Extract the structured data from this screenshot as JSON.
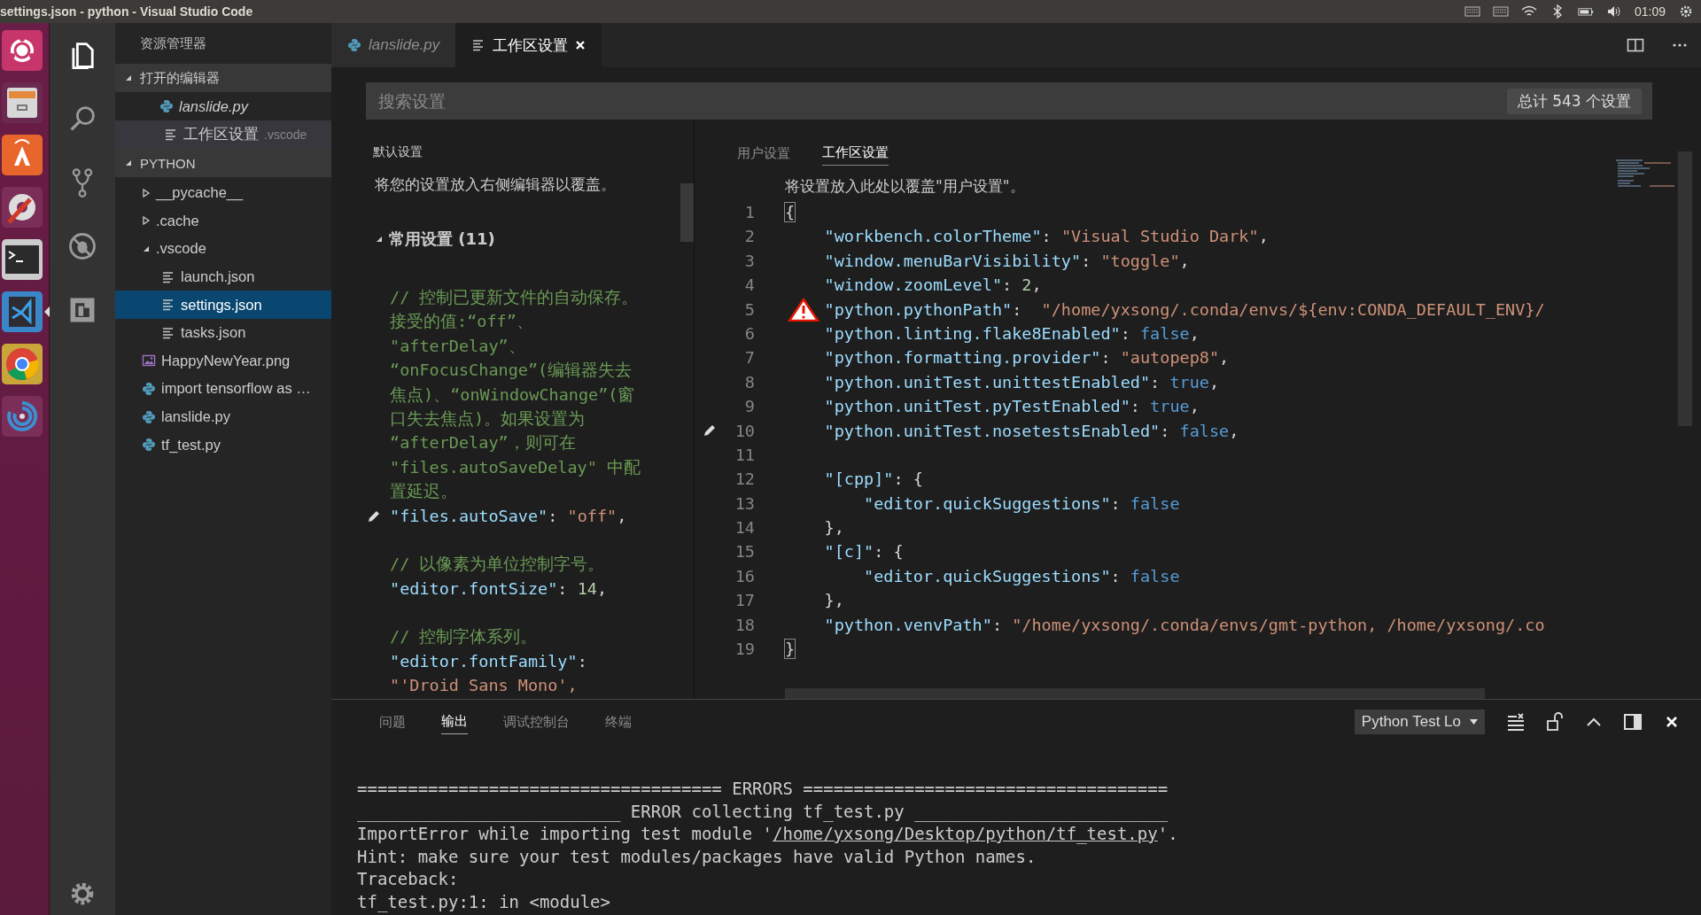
{
  "title_bar": {
    "title": "settings.json - python - Visual Studio Code",
    "clock": "01:09"
  },
  "launcher": {
    "items": [
      {
        "kind": "ubuntu",
        "selected": false
      },
      {
        "kind": "files",
        "selected": false
      },
      {
        "kind": "store",
        "selected": false
      },
      {
        "kind": "tools",
        "selected": false
      },
      {
        "kind": "terminal",
        "selected": false
      },
      {
        "kind": "vscode",
        "selected": true
      },
      {
        "kind": "chrome",
        "selected": false
      },
      {
        "kind": "spiral",
        "selected": false
      }
    ]
  },
  "activity_bar": {
    "items": [
      {
        "kind": "explorer",
        "selected": true
      },
      {
        "kind": "search",
        "selected": false
      },
      {
        "kind": "git",
        "selected": false
      },
      {
        "kind": "debug",
        "selected": false
      },
      {
        "kind": "extensions",
        "selected": false
      }
    ]
  },
  "sidebar": {
    "title": "资源管理器",
    "open_editors": {
      "title": "打开的编辑器",
      "expanded": true,
      "items": [
        {
          "kind": "python",
          "label": "lanslide.py",
          "preview": true,
          "selected": false
        },
        {
          "kind": "settings",
          "label": "工作区设置",
          "detail": ".vscode",
          "preview": false,
          "selected": true
        }
      ]
    },
    "folder": {
      "title": "PYTHON",
      "expanded": true,
      "items": [
        {
          "kind": "folder",
          "label": "__pycache__",
          "expanded": false,
          "selected": false
        },
        {
          "kind": "folder",
          "label": ".cache",
          "expanded": false,
          "selected": false
        },
        {
          "kind": "folder",
          "label": ".vscode",
          "expanded": true,
          "selected": false,
          "children": [
            {
              "kind": "json",
              "label": "launch.json",
              "selected": false
            },
            {
              "kind": "json",
              "label": "settings.json",
              "selected": true
            },
            {
              "kind": "json",
              "label": "tasks.json",
              "selected": false
            }
          ]
        },
        {
          "kind": "image",
          "label": "HappyNewYear.png",
          "selected": false
        },
        {
          "kind": "python",
          "label": "import tensorflow as …",
          "selected": false
        },
        {
          "kind": "python",
          "label": "lanslide.py",
          "selected": false
        },
        {
          "kind": "python",
          "label": "tf_test.py",
          "selected": false
        }
      ]
    }
  },
  "editor_tabs": [
    {
      "kind": "python",
      "label": "lanslide.py",
      "preview": true,
      "selected": false
    },
    {
      "kind": "settings",
      "label": "工作区设置",
      "preview": false,
      "selected": true
    }
  ],
  "search": {
    "placeholder": "搜索设置",
    "count": "总计 543 个设置"
  },
  "default_settings": {
    "title": "默认设置",
    "intro": "将您的设置放入右侧编辑器以覆盖。",
    "group": {
      "title": "常用设置 (11)",
      "expanded": true
    },
    "lines": [
      {
        "kind": "comment",
        "edited": false,
        "text": "// 控制已更新文件的自动保存。"
      },
      {
        "kind": "comment",
        "edited": false,
        "text": "接受的值:“off”、"
      },
      {
        "kind": "comment",
        "edited": false,
        "text": "\"afterDelay”、"
      },
      {
        "kind": "comment",
        "edited": false,
        "text": "“onFocusChange”(编辑器失去"
      },
      {
        "kind": "comment",
        "edited": false,
        "text": "焦点)、“onWindowChange”(窗"
      },
      {
        "kind": "comment",
        "edited": false,
        "text": "口失去焦点)。如果设置为"
      },
      {
        "kind": "comment",
        "edited": false,
        "text": "“afterDelay”，则可在"
      },
      {
        "kind": "comment",
        "edited": false,
        "text": "\"files.autoSaveDelay\" 中配"
      },
      {
        "kind": "comment",
        "edited": false,
        "text": "置延迟。"
      },
      {
        "kind": "code",
        "edited": true,
        "tokens": [
          {
            "kind": "key",
            "text": "\"files.autoSave\""
          },
          {
            "kind": "punct",
            "text": ": "
          },
          {
            "kind": "string",
            "text": "\"off\""
          },
          {
            "kind": "punct",
            "text": ","
          }
        ]
      },
      {
        "kind": "blank",
        "edited": false
      },
      {
        "kind": "comment",
        "edited": false,
        "text": "// 以像素为单位控制字号。"
      },
      {
        "kind": "code",
        "edited": false,
        "tokens": [
          {
            "kind": "key",
            "text": "\"editor.fontSize\""
          },
          {
            "kind": "punct",
            "text": ": "
          },
          {
            "kind": "number",
            "text": "14"
          },
          {
            "kind": "punct",
            "text": ","
          }
        ]
      },
      {
        "kind": "blank",
        "edited": false
      },
      {
        "kind": "comment",
        "edited": false,
        "text": "// 控制字体系列。"
      },
      {
        "kind": "code",
        "edited": false,
        "tokens": [
          {
            "kind": "key",
            "text": "\"editor.fontFamily\""
          },
          {
            "kind": "punct",
            "text": ":"
          }
        ]
      },
      {
        "kind": "code",
        "edited": false,
        "tokens": [
          {
            "kind": "string",
            "text": "\"'Droid Sans Mono',"
          }
        ]
      }
    ]
  },
  "settings_editor": {
    "tabs": [
      {
        "label": "用户设置",
        "selected": false
      },
      {
        "label": "工作区设置",
        "selected": true
      }
    ],
    "intro": "将设置放入此处以覆盖\"用户设置\"。",
    "lines": [
      {
        "number": "1",
        "edited": false,
        "warning": false,
        "tokens": [
          {
            "kind": "bracket",
            "text": "{"
          }
        ],
        "children": [
          {
            "number": "2",
            "edited": false,
            "warning": false,
            "tokens": [
              {
                "kind": "key",
                "text": "\"workbench.colorTheme\""
              },
              {
                "kind": "punct",
                "text": ": "
              },
              {
                "kind": "string",
                "text": "\"Visual Studio Dark\""
              },
              {
                "kind": "punct",
                "text": ","
              }
            ]
          },
          {
            "number": "3",
            "edited": false,
            "warning": false,
            "tokens": [
              {
                "kind": "key",
                "text": "\"window.menuBarVisibility\""
              },
              {
                "kind": "punct",
                "text": ": "
              },
              {
                "kind": "string",
                "text": "\"toggle\""
              },
              {
                "kind": "punct",
                "text": ","
              }
            ]
          },
          {
            "number": "4",
            "edited": false,
            "warning": false,
            "tokens": [
              {
                "kind": "key",
                "text": "\"window.zoomLevel\""
              },
              {
                "kind": "punct",
                "text": ": "
              },
              {
                "kind": "number",
                "text": "2"
              },
              {
                "kind": "punct",
                "text": ","
              }
            ]
          },
          {
            "number": "5",
            "edited": false,
            "warning": true,
            "tokens": [
              {
                "kind": "key",
                "text": "\"python.pythonPath\""
              },
              {
                "kind": "punct",
                "text": ":  "
              },
              {
                "kind": "string",
                "text": "\"/home/yxsong/.conda/envs/${env:CONDA_DEFAULT_ENV}/"
              }
            ]
          },
          {
            "number": "6",
            "edited": false,
            "warning": false,
            "tokens": [
              {
                "kind": "key",
                "text": "\"python.linting.flake8Enabled\""
              },
              {
                "kind": "punct",
                "text": ": "
              },
              {
                "kind": "bool",
                "text": "false"
              },
              {
                "kind": "punct",
                "text": ","
              }
            ]
          },
          {
            "number": "7",
            "edited": false,
            "warning": false,
            "tokens": [
              {
                "kind": "key",
                "text": "\"python.formatting.provider\""
              },
              {
                "kind": "punct",
                "text": ": "
              },
              {
                "kind": "string",
                "text": "\"autopep8\""
              },
              {
                "kind": "punct",
                "text": ","
              }
            ]
          },
          {
            "number": "8",
            "edited": false,
            "warning": false,
            "tokens": [
              {
                "kind": "key",
                "text": "\"python.unitTest.unittestEnabled\""
              },
              {
                "kind": "punct",
                "text": ": "
              },
              {
                "kind": "bool",
                "text": "true"
              },
              {
                "kind": "punct",
                "text": ","
              }
            ]
          },
          {
            "number": "9",
            "edited": false,
            "warning": false,
            "tokens": [
              {
                "kind": "key",
                "text": "\"python.unitTest.pyTestEnabled\""
              },
              {
                "kind": "punct",
                "text": ": "
              },
              {
                "kind": "bool",
                "text": "true"
              },
              {
                "kind": "punct",
                "text": ","
              }
            ]
          },
          {
            "number": "10",
            "edited": true,
            "warning": false,
            "tokens": [
              {
                "kind": "key",
                "text": "\"python.unitTest.nosetestsEnabled\""
              },
              {
                "kind": "punct",
                "text": ": "
              },
              {
                "kind": "bool",
                "text": "false"
              },
              {
                "kind": "punct",
                "text": ","
              }
            ]
          },
          {
            "number": "11",
            "edited": false,
            "warning": false
          },
          {
            "number": "12",
            "edited": false,
            "warning": false,
            "tokens": [
              {
                "kind": "key",
                "text": "\"[cpp]\""
              },
              {
                "kind": "punct",
                "text": ": {"
              }
            ],
            "children": [
              {
                "number": "13",
                "edited": false,
                "warning": false,
                "tokens": [
                  {
                    "kind": "key",
                    "text": "\"editor.quickSuggestions\""
                  },
                  {
                    "kind": "punct",
                    "text": ": "
                  },
                  {
                    "kind": "bool",
                    "text": "false"
                  }
                ]
              }
            ]
          },
          {
            "number": "14",
            "edited": false,
            "warning": false,
            "tokens": [
              {
                "kind": "punct",
                "text": "},"
              }
            ]
          },
          {
            "number": "15",
            "edited": false,
            "warning": false,
            "tokens": [
              {
                "kind": "key",
                "text": "\"[c]\""
              },
              {
                "kind": "punct",
                "text": ": {"
              }
            ],
            "children": [
              {
                "number": "16",
                "edited": false,
                "warning": false,
                "tokens": [
                  {
                    "kind": "key",
                    "text": "\"editor.quickSuggestions\""
                  },
                  {
                    "kind": "punct",
                    "text": ": "
                  },
                  {
                    "kind": "bool",
                    "text": "false"
                  }
                ]
              }
            ]
          },
          {
            "number": "17",
            "edited": false,
            "warning": false,
            "tokens": [
              {
                "kind": "punct",
                "text": "},"
              }
            ]
          },
          {
            "number": "18",
            "edited": false,
            "warning": false,
            "tokens": [
              {
                "kind": "key",
                "text": "\"python.venvPath\""
              },
              {
                "kind": "punct",
                "text": ": "
              },
              {
                "kind": "string",
                "text": "\"/home/yxsong/.conda/envs/gmt-python, /home/yxsong/.co"
              }
            ]
          }
        ]
      },
      {
        "number": "19",
        "edited": false,
        "warning": false,
        "tokens": [
          {
            "kind": "bracket",
            "text": "}"
          }
        ]
      }
    ]
  },
  "panel": {
    "tabs": [
      {
        "label": "问题",
        "selected": false
      },
      {
        "label": "输出",
        "selected": true
      },
      {
        "label": "调试控制台",
        "selected": false
      },
      {
        "label": "终端",
        "selected": false
      }
    ],
    "channel": "Python Test Lo",
    "lines": [
      {
        "tokens": [
          {
            "kind": "text",
            "text": "==================================== ERRORS ===================================="
          }
        ]
      },
      {
        "tokens": [
          {
            "kind": "text",
            "text": "__________________________ ERROR collecting tf_test.py _________________________"
          }
        ]
      },
      {
        "tokens": [
          {
            "kind": "text",
            "text": "ImportError while importing test module '"
          },
          {
            "kind": "link",
            "text": "/home/yxsong/Desktop/python/tf_test.py"
          },
          {
            "kind": "text",
            "text": "'."
          }
        ]
      },
      {
        "tokens": [
          {
            "kind": "text",
            "text": "Hint: make sure your test modules/packages have valid Python names."
          }
        ]
      },
      {
        "tokens": [
          {
            "kind": "text",
            "text": "Traceback:"
          }
        ]
      },
      {
        "tokens": [
          {
            "kind": "text",
            "text": "tf_test.py:1: in <module>"
          }
        ]
      }
    ]
  }
}
